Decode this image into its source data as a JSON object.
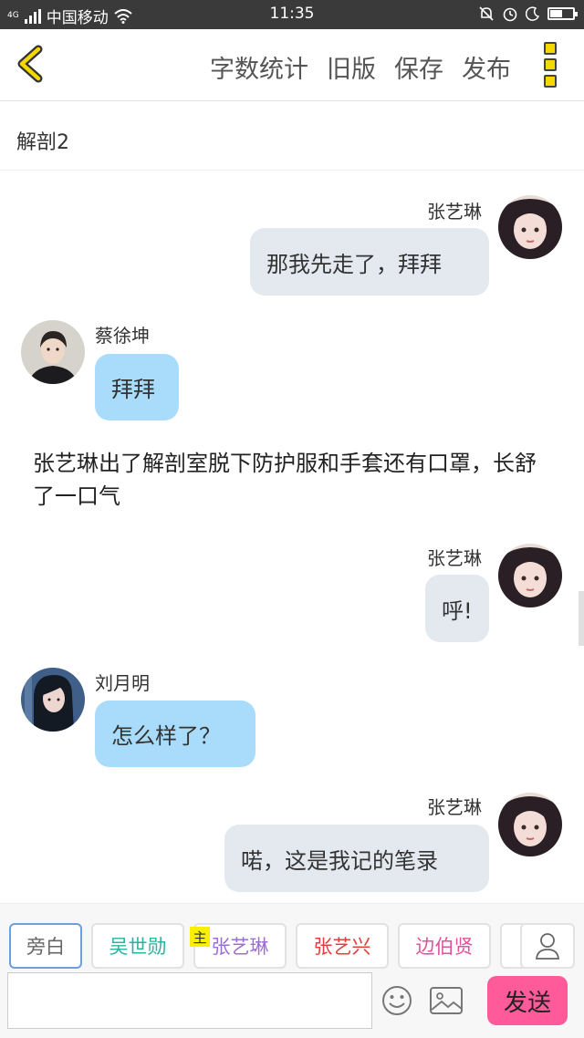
{
  "status_bar": {
    "network_type": "4G",
    "carrier": "中国移动",
    "time": "11:35",
    "battery_level": 0.55
  },
  "toolbar": {
    "word_count": "字数统计",
    "old_version": "旧版",
    "save": "保存",
    "publish": "发布"
  },
  "document": {
    "title": "解剖2"
  },
  "messages": [
    {
      "speaker": "张艺琳",
      "text": "那我先走了，拜拜",
      "side": "right"
    },
    {
      "speaker": "蔡徐坤",
      "text": "拜拜",
      "side": "left"
    },
    {
      "type": "narration",
      "text": "张艺琳出了解剖室脱下防护服和手套还有口罩，长舒了一口气"
    },
    {
      "speaker": "张艺琳",
      "text": "呼!",
      "side": "right"
    },
    {
      "speaker": "刘月明",
      "text": "怎么样了？",
      "side": "left"
    },
    {
      "speaker": "张艺琳",
      "text": "喏，这是我记的笔录",
      "side": "right"
    }
  ],
  "characters": [
    {
      "label": "旁白",
      "color": "#666666",
      "selected": true
    },
    {
      "label": "吴世勋",
      "color": "#2bb3a0"
    },
    {
      "label": "张艺琳",
      "color": "#9b6fd4",
      "main_tag": "主"
    },
    {
      "label": "张艺兴",
      "color": "#e0403a"
    },
    {
      "label": "边伯贤",
      "color": "#e0529c"
    }
  ],
  "input": {
    "value": "",
    "send_label": "发送"
  },
  "colors": {
    "send_button": "#ff5a99",
    "left_bubble": "#a9dcfa",
    "right_bubble": "#e3e9ef",
    "menu_accent": "#f5d800"
  }
}
